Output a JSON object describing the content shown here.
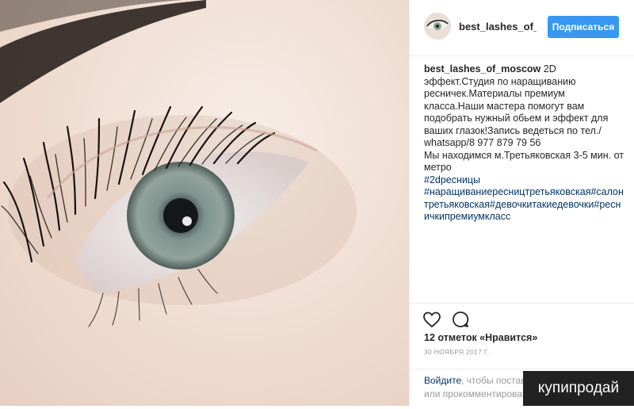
{
  "post": {
    "image_alt_subject": "eye-lash-photo",
    "account": {
      "username_truncated": "best_lashes_of_mo",
      "username": "best_lashes_of_moscow",
      "follow_label": "Подписаться"
    },
    "caption": {
      "text": "2D эффект.Студия по наращиванию ресничек.Материалы премиум класса.Наши мастера помогут вам подобрать нужный обьем и эффект для ваших глазок!Запись ведеться по тел./ whatsapp/8 977 879 79 56",
      "location_line": "Мы находимся м.Третьяковская 3-5 мин. от метро",
      "hashtag1": "#2dресницы",
      "hashtag2": "#наращиваниересництретьяковская#салонтретьяковская#девочкитакиедевочки#ресничкипремиумкласс"
    },
    "likes": "12 отметок «Нравится»",
    "date": "30 НОЯБРЯ 2017 Г.",
    "login_prompt": {
      "link": "Войдите",
      "text": ", чтобы поставить",
      "line2": "или прокомментировать"
    }
  },
  "icons": {
    "like": "heart-icon",
    "comment": "comment-icon"
  },
  "colors": {
    "follow_button": "#3897f0",
    "hashtag": "#003569",
    "muted": "#999999"
  },
  "watermark": {
    "text": "купипродай"
  }
}
